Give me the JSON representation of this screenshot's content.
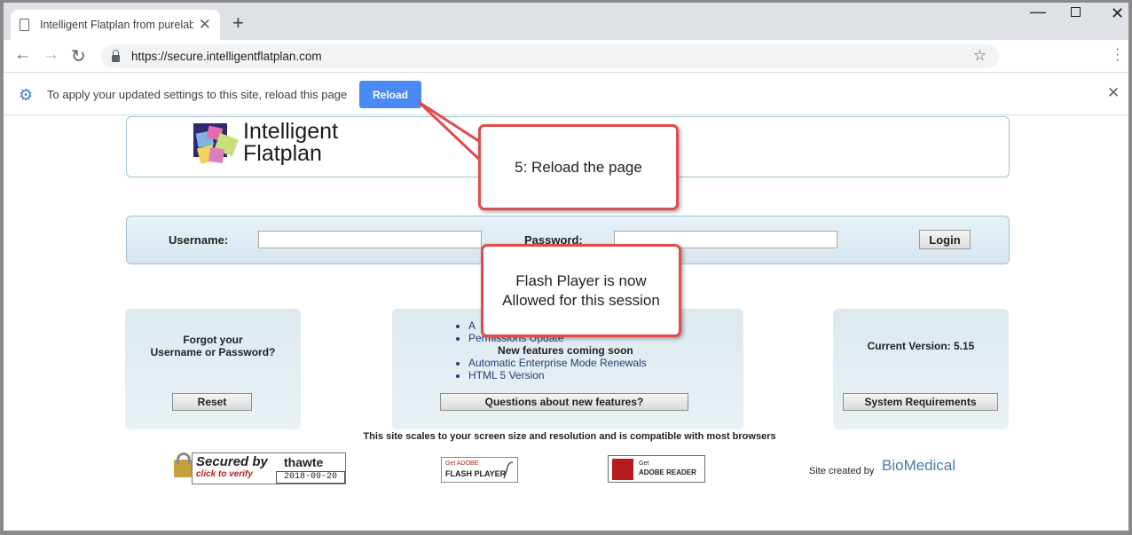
{
  "browser": {
    "tab_title": "Intelligent Flatplan from purelabs",
    "tab_close": "✕",
    "new_tab": "+",
    "url": "https://secure.intelligentflatplan.com"
  },
  "infobar": {
    "message": "To apply your updated settings to this site, reload this page",
    "reload_label": "Reload",
    "close": "✕"
  },
  "logo": {
    "line1": "Intelligent",
    "line2": "Flatplan"
  },
  "login": {
    "username_label": "Username:",
    "password_label": "Password:",
    "username_value": "",
    "password_value": "",
    "login_label": "Login"
  },
  "forgot_panel": {
    "line1": "Forgot your",
    "line2": "Username or Password?",
    "reset_label": "Reset"
  },
  "features_panel": {
    "items": [
      "A",
      "Permissions Update"
    ],
    "coming_soon": "New features coming soon",
    "upcoming": [
      "Automatic Enterprise Mode Renewals",
      "HTML 5 Version"
    ],
    "button_label": "Questions about new features?"
  },
  "version_panel": {
    "version": "Current Version: 5.15",
    "button_label": "System Requirements"
  },
  "footer": {
    "compat_text": "This site scales to your screen size and resolution and is compatible with most browsers",
    "thawte_main": "Secured by",
    "thawte_sub": "click to verify",
    "thawte_brand": "thawte",
    "thawte_date": "2018-09-20",
    "flash_a": "Get ADOBE",
    "flash_b": "FLASH PLAYER",
    "reader_a": "Get",
    "reader_b": "ADOBE READER",
    "site_created": "Site created by",
    "biomedical": "BioMedical"
  },
  "callouts": {
    "step5": "5: Reload the page",
    "flash_line1": "Flash Player is now",
    "flash_line2": "Allowed for this session"
  },
  "colors": {
    "accent_blue": "#4a8af4",
    "callout_red": "#e04b4b",
    "panel_bg": "#dde9f0"
  }
}
